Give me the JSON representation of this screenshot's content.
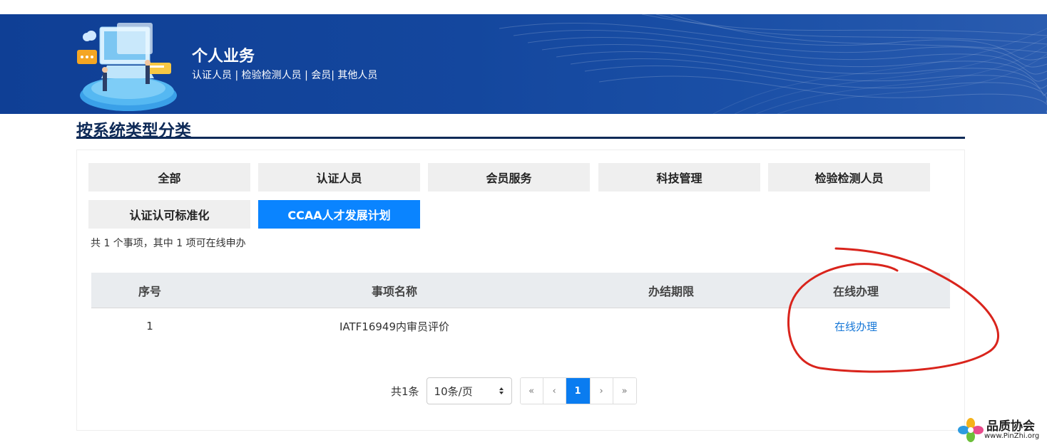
{
  "header": {
    "title": "个人业务",
    "subtitle": "认证人员 | 检验检测人员 | 会员| 其他人员"
  },
  "section": {
    "title": "按系统类型分类"
  },
  "tabs": [
    {
      "label": "全部",
      "active": false
    },
    {
      "label": "认证人员",
      "active": false
    },
    {
      "label": "会员服务",
      "active": false
    },
    {
      "label": "科技管理",
      "active": false
    },
    {
      "label": "检验检测人员",
      "active": false
    },
    {
      "label": "认证认可标准化",
      "active": false
    },
    {
      "label": "CCAA人才发展计划",
      "active": true
    }
  ],
  "summary": "共 1 个事项，其中 1 项可在线申办",
  "table": {
    "headers": [
      "序号",
      "事项名称",
      "办结期限",
      "在线办理"
    ],
    "rows": [
      {
        "index": "1",
        "name": "IATF16949内审员评价",
        "deadline": "",
        "action": "在线办理"
      }
    ]
  },
  "pagination": {
    "total": "共1条",
    "page_size": "10条/页",
    "first": "«",
    "prev": "‹",
    "current": "1",
    "next": "›",
    "last": "»"
  },
  "watermark": {
    "name": "品质协会",
    "url": "www.PinZhi.org"
  },
  "colors": {
    "banner": "#14479e",
    "accent": "#0a84ff",
    "link": "#1677d7",
    "annotation": "#d9241c"
  }
}
